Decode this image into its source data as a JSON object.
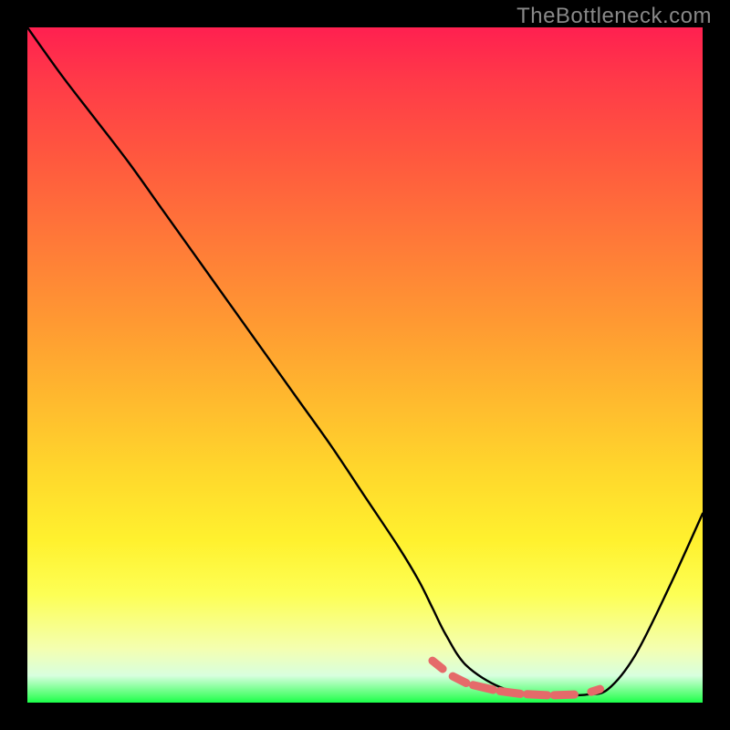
{
  "watermark": "TheBottleneck.com",
  "chart_data": {
    "type": "line",
    "title": "",
    "xlabel": "",
    "ylabel": "",
    "xlim": [
      0,
      100
    ],
    "ylim": [
      0,
      100
    ],
    "series": [
      {
        "name": "bottleneck-curve",
        "x": [
          0,
          5,
          10,
          15,
          20,
          25,
          30,
          35,
          40,
          45,
          50,
          55,
          58,
          60,
          62,
          65,
          70,
          75,
          80,
          83,
          86,
          90,
          95,
          100
        ],
        "y": [
          100,
          93,
          86.5,
          80,
          73,
          66,
          59,
          52,
          45,
          38,
          30.5,
          23,
          18,
          14,
          10,
          5.5,
          2.3,
          1.3,
          1.1,
          1.2,
          2.0,
          7,
          17,
          28
        ]
      }
    ],
    "highlight": {
      "name": "valley-highlight",
      "color": "#e56a6a",
      "segments": [
        {
          "x": [
            60,
            61.5
          ],
          "y": [
            6.2,
            5.0
          ]
        },
        {
          "x": [
            63,
            65
          ],
          "y": [
            3.9,
            2.9
          ]
        },
        {
          "x": [
            66,
            69
          ],
          "y": [
            2.6,
            1.9
          ]
        },
        {
          "x": [
            70,
            73
          ],
          "y": [
            1.7,
            1.3
          ]
        },
        {
          "x": [
            74,
            77
          ],
          "y": [
            1.25,
            1.1
          ]
        },
        {
          "x": [
            78,
            81
          ],
          "y": [
            1.1,
            1.2
          ]
        },
        {
          "x": [
            83.5,
            84.8
          ],
          "y": [
            1.6,
            2.0
          ]
        }
      ]
    },
    "gradient_stops": [
      {
        "pct": 0,
        "color": "#ff2050"
      },
      {
        "pct": 50,
        "color": "#ffb92e"
      },
      {
        "pct": 85,
        "color": "#fdff55"
      },
      {
        "pct": 100,
        "color": "#1aff4a"
      }
    ]
  }
}
